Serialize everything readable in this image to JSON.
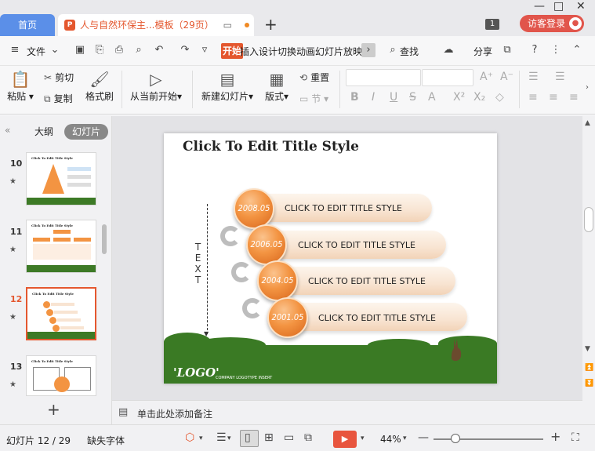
{
  "titlebar": {
    "home_tab": "首页",
    "doc_tab": "人与自然环保主...模板（29页）",
    "doc_icon": "P",
    "new_tab": "+",
    "window_count": "1",
    "login_label": "访客登录",
    "controls": [
      "—",
      "□",
      "✕"
    ]
  },
  "menu": {
    "file_label": "文件",
    "tabs": [
      "开始",
      "插入",
      "设计",
      "切换",
      "动画",
      "幻灯片放映"
    ],
    "active_tab": "开始",
    "search_label": "查找",
    "share_label": "分享",
    "help_icon": "?"
  },
  "ribbon": {
    "paste_label": "粘贴",
    "cut_label": "剪切",
    "copy_label": "复制",
    "format_painter_label": "格式刷",
    "play_from_current_label": "从当前开始",
    "new_slide_label": "新建幻灯片",
    "layout_label": "版式",
    "reset_label": "重置",
    "section_label": "节"
  },
  "left_panel": {
    "outline_tab": "大纲",
    "slides_tab": "幻灯片",
    "thumbnails": [
      {
        "number": "10",
        "title": "Click To Edit Title Style",
        "selected": false
      },
      {
        "number": "11",
        "title": "Click To Edit Title Style",
        "selected": false
      },
      {
        "number": "12",
        "title": "Click To Edit Title Style",
        "selected": true
      },
      {
        "number": "13",
        "title": "Click To Edit Title Style",
        "selected": false
      }
    ],
    "add_slide": "+"
  },
  "slide": {
    "title": "Click To Edit Title Style",
    "side_text": "TEXT",
    "items": [
      {
        "year": "2008.05",
        "label": "CLICK TO EDIT TITLE STYLE"
      },
      {
        "year": "2006.05",
        "label": "CLICK TO EDIT TITLE STYLE"
      },
      {
        "year": "2004.05",
        "label": "CLICK TO EDIT TITLE STYLE"
      },
      {
        "year": "2001.05",
        "label": "CLICK TO EDIT TITLE STYLE"
      }
    ],
    "logo": "'LOGO'",
    "logo_sub": "COMPANY LOGOTYPE INSERT"
  },
  "notes": {
    "placeholder": "单击此处添加备注"
  },
  "status": {
    "slide_counter": "幻灯片 12 / 29",
    "font_status": "缺失字体",
    "zoom": "44%",
    "colors": {
      "accent": "#e4572e",
      "play": "#e8553e"
    }
  }
}
